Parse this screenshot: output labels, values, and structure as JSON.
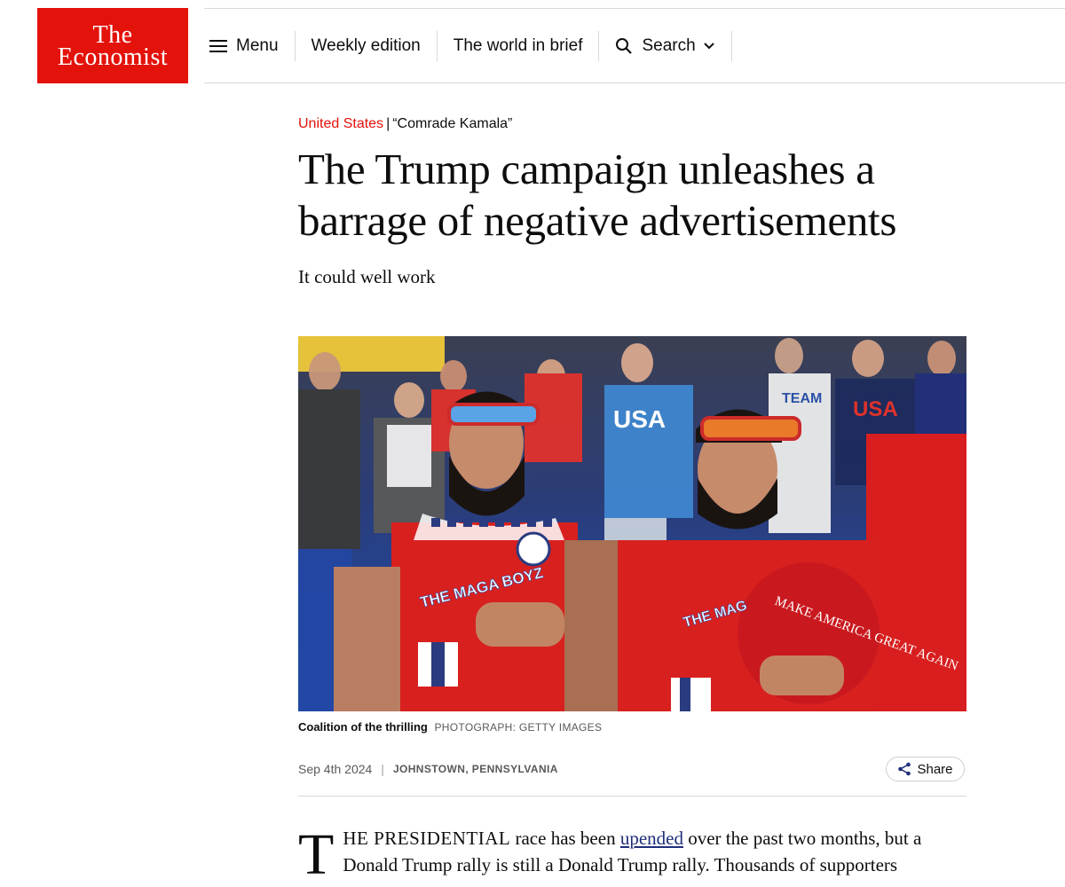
{
  "logo": {
    "line1": "The",
    "line2": "Economist"
  },
  "nav": {
    "menu": "Menu",
    "weekly_edition": "Weekly edition",
    "world_in_brief": "The world in brief",
    "search": "Search"
  },
  "article": {
    "section": "United States",
    "separator": "|",
    "fly_title": "“Comrade Kamala”",
    "headline": "The Trump campaign unleashes a barrage of negative advertisements",
    "standfirst": "It could well work",
    "image_alt": "Two bearded men in red MAGA shirts with hands on hearts at a rally",
    "caption": "Coalition of the thrilling",
    "credit": "PHOTOGRAPH: GETTY IMAGES",
    "date": "Sep 4th 2024",
    "meta_sep": "|",
    "location": "JOHNSTOWN, PENNSYLVANIA",
    "share": "Share",
    "dropcap": "T",
    "lead_smallcaps": "HE PRESIDENTIAL",
    "body_1": " race has been ",
    "body_link": "upended",
    "body_2": " over the past two months, but a Donald Trump rally is still a Donald Trump rally. Thousands of supporters"
  },
  "photo_text": {
    "shirt_usa": "USA",
    "shirt_usa2": "USA",
    "shirt_maga": "THE MAGA BOYZ",
    "shirt_maga2": "THE MAG",
    "hat": "MAKE AMERICA GREAT AGAIN",
    "team": "TEAM"
  },
  "colors": {
    "brand_red": "#e3120b",
    "link_blue": "#1f2e7a"
  }
}
